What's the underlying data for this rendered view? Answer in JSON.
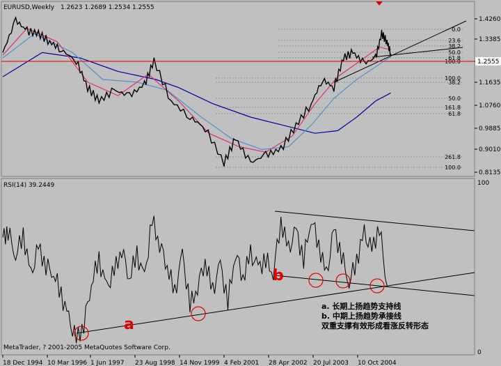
{
  "chart_data": [
    {
      "type": "line",
      "panel": "price",
      "header": {
        "symbol": "EURUSD,Weekly",
        "ohlc": "1.2623 1.2689 1.2534 1.2555"
      },
      "y_ticks": [
        "1.4260",
        "1.3385",
        "1.2555",
        "1.1635",
        "1.0760",
        "0.9885",
        "0.9010",
        "0.8135"
      ],
      "current_price": "1.2555",
      "fib_upper": [
        "0.0",
        "23.6",
        "38.2",
        "50.0",
        "61.8",
        "100.0"
      ],
      "fib_lower": [
        "38.2",
        "50.0",
        "61.8",
        "100.0",
        "161.8",
        "261.8"
      ],
      "fib_lower_labels": [
        "100.0",
        "38.2",
        "50.0",
        "161.8",
        "61.8",
        "261.8",
        "100.0"
      ],
      "series": [
        {
          "name": "EURUSD",
          "x": [
            1994.96,
            1995.3,
            1995.6,
            1995.9,
            1996.2,
            1996.5,
            1996.9,
            1997.2,
            1997.5,
            1997.9,
            1998.3,
            1998.7,
            1998.95,
            1999.4,
            1999.9,
            2000.3,
            2000.8,
            2001.1,
            2001.5,
            2001.9,
            2002.3,
            2002.7,
            2003.1,
            2003.4,
            2003.7,
            2003.95,
            2004.2,
            2004.5,
            2004.8,
            2004.96,
            2005.1,
            2005.2
          ],
          "values": [
            1.26,
            1.38,
            1.34,
            1.33,
            1.3,
            1.27,
            1.23,
            1.13,
            1.08,
            1.12,
            1.1,
            1.14,
            1.23,
            1.08,
            1.02,
            0.98,
            0.85,
            0.94,
            0.85,
            0.88,
            0.9,
            0.99,
            1.07,
            1.16,
            1.13,
            1.24,
            1.26,
            1.22,
            1.24,
            1.33,
            1.3,
            1.2555
          ]
        }
      ],
      "moving_averages": [
        {
          "color": "#0000a0",
          "x": [
            1994.96,
            1996.0,
            1997.0,
            1998.0,
            1999.0,
            1999.6,
            2000.5,
            2001.5,
            2002.5,
            2003.2,
            2003.8,
            2004.3,
            2004.8,
            2005.2
          ],
          "values": [
            1.17,
            1.26,
            1.24,
            1.19,
            1.16,
            1.13,
            1.07,
            1.02,
            0.985,
            0.96,
            0.97,
            1.02,
            1.08,
            1.11
          ]
        },
        {
          "color": "#5090d0",
          "x": [
            1994.96,
            1995.8,
            1996.8,
            1997.6,
            1998.5,
            1999.3,
            2000.2,
            2001.0,
            2001.8,
            2002.5,
            2003.1,
            2003.7,
            2004.3,
            2005.2
          ],
          "values": [
            1.24,
            1.33,
            1.26,
            1.16,
            1.15,
            1.12,
            1.02,
            0.94,
            0.9,
            0.91,
            0.99,
            1.09,
            1.16,
            1.245
          ]
        },
        {
          "color": "#e0307a",
          "x": [
            1994.96,
            1995.6,
            1996.4,
            1997.2,
            1998.0,
            1998.8,
            1999.6,
            2000.4,
            2001.2,
            2001.9,
            2002.6,
            2003.2,
            2003.8,
            2004.4,
            2004.9,
            2005.2
          ],
          "values": [
            1.25,
            1.35,
            1.3,
            1.15,
            1.1,
            1.18,
            1.08,
            0.96,
            0.91,
            0.89,
            0.95,
            1.07,
            1.17,
            1.23,
            1.28,
            1.27
          ]
        }
      ],
      "ylim": [
        0.8,
        1.45
      ]
    },
    {
      "type": "line",
      "panel": "rsi",
      "header": "RSI(14) 39.2449",
      "y_ticks": [
        "100",
        "0"
      ],
      "x_ticks": [
        "18 Dec 1994",
        "10 Mar 1996",
        "1 Jun 1997",
        "23 Aug 1998",
        "14 Nov 1999",
        "4 Feb 2001",
        "28 Apr 2002",
        "20 Jul 2003",
        "10 Oct 2004"
      ],
      "series": [
        {
          "name": "RSI(14)",
          "x": [
            1994.96,
            1995.1,
            1995.3,
            1995.5,
            1995.7,
            1995.9,
            1996.1,
            1996.3,
            1996.5,
            1996.7,
            1996.9,
            1997.1,
            1997.3,
            1997.5,
            1997.7,
            1997.9,
            1998.1,
            1998.3,
            1998.5,
            1998.7,
            1998.9,
            1999.1,
            1999.3,
            1999.5,
            1999.7,
            1999.9,
            2000.1,
            2000.3,
            2000.5,
            2000.7,
            2000.9,
            2001.1,
            2001.3,
            2001.5,
            2001.7,
            2001.9,
            2002.1,
            2002.3,
            2002.5,
            2002.7,
            2002.9,
            2003.1,
            2003.3,
            2003.5,
            2003.7,
            2003.9,
            2004.1,
            2004.3,
            2004.5,
            2004.7,
            2004.9,
            2005.1
          ],
          "values": [
            68,
            72,
            58,
            70,
            45,
            62,
            52,
            48,
            35,
            20,
            8,
            18,
            42,
            55,
            38,
            48,
            62,
            45,
            58,
            44,
            78,
            65,
            52,
            35,
            58,
            28,
            40,
            55,
            36,
            52,
            30,
            60,
            45,
            58,
            50,
            55,
            48,
            78,
            60,
            72,
            55,
            80,
            64,
            45,
            72,
            58,
            42,
            55,
            70,
            60,
            75,
            40
          ]
        }
      ],
      "ylim": [
        0,
        100
      ]
    }
  ],
  "annotations": {
    "label_a": "a",
    "label_b": "b",
    "legend_a": "a. 长期上扬趋势支持线",
    "legend_b": "b. 中期上扬趋势承接线",
    "legend_c": "双重支撑有效形成看涨反转形态"
  },
  "footer": "MetaTrader, ? 2001-2005 MetaQuotes Software Corp.",
  "colors": {
    "bg": "#c0c0c0",
    "price": "#000000",
    "current_line": "#e00000",
    "ma_blue": "#0000a0",
    "ma_light": "#5090d0",
    "ma_pink": "#e0307a",
    "circle": "#e00000",
    "label": "#e00000"
  }
}
